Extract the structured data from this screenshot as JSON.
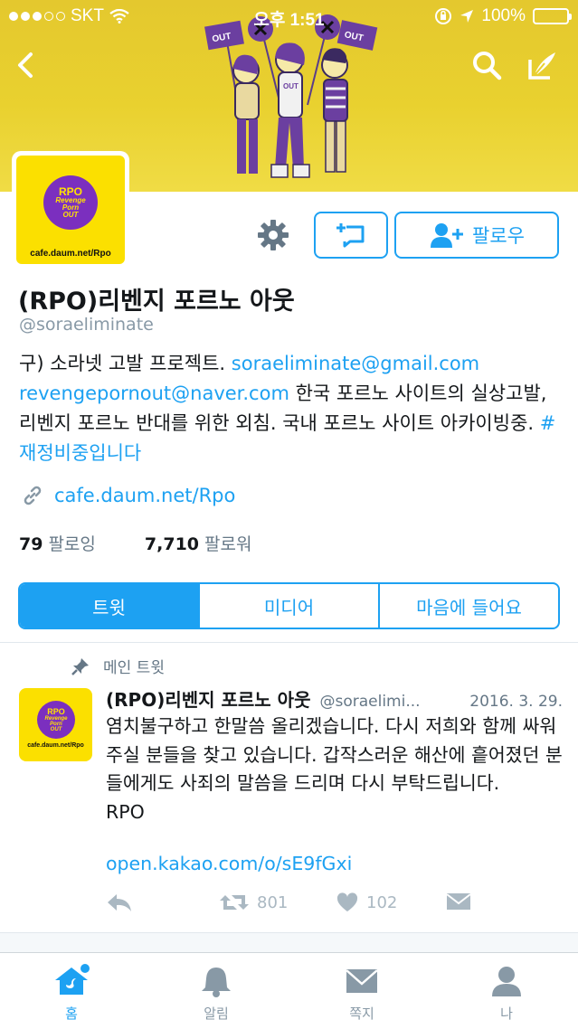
{
  "status_bar": {
    "carrier": "SKT",
    "time": "오후 1:51",
    "battery_percent": "100%"
  },
  "profile": {
    "display_name": "(RPO)리벤지 포르노 아웃",
    "handle": "@soraeliminate",
    "avatar_logo": {
      "top": "RPO",
      "line1": "Revenge",
      "line2": "Porn",
      "line3": "OUT",
      "url": "cafe.daum.net/Rpo"
    },
    "follow_label": "팔로우",
    "bio": {
      "part1": "구) 소라넷 고발 프로젝트. ",
      "email1": "soraeliminate@gmail.com",
      "email2": "revengepornout@naver.com",
      "part2": " 한국 포르노 사이트의 실상고발, 리벤지 포르노 반대를 위한 외침. 국내 포르노 사이트 아카이빙중. ",
      "hashtag": "#재정비중입니다"
    },
    "website": "cafe.daum.net/Rpo",
    "following_count": "79",
    "following_label": "팔로잉",
    "followers_count": "7,710",
    "followers_label": "팔로워"
  },
  "tabs": [
    {
      "label": "트윗",
      "active": true
    },
    {
      "label": "미디어",
      "active": false
    },
    {
      "label": "마음에 들어요",
      "active": false
    }
  ],
  "pinned_tweet": {
    "pinned_label": "메인 트윗",
    "name": "(RPO)리벤지 포르노 아웃",
    "handle": "@soraelimi...",
    "date": "2016. 3. 29.",
    "body": "염치불구하고 한말씀 올리겠습니다. 다시 저희와 함께 싸워주실 분들을 찾고 있습니다. 갑작스러운 해산에 흩어졌던 분들에게도 사죄의 말씀을 드리며 다시 부탁드립니다.\nRPO",
    "link": "open.kakao.com/o/sE9fGxi",
    "retweets": "801",
    "likes": "102"
  },
  "bottom_tabs": [
    {
      "label": "홈",
      "icon": "home-icon",
      "active": true
    },
    {
      "label": "알림",
      "icon": "bell-icon",
      "active": false
    },
    {
      "label": "쪽지",
      "icon": "envelope-icon",
      "active": false
    },
    {
      "label": "나",
      "icon": "person-icon",
      "active": false
    }
  ],
  "colors": {
    "accent": "#1da1f2",
    "banner": "#e9d12f",
    "logo_purple": "#7b2fbf",
    "logo_yellow": "#fbe000"
  }
}
